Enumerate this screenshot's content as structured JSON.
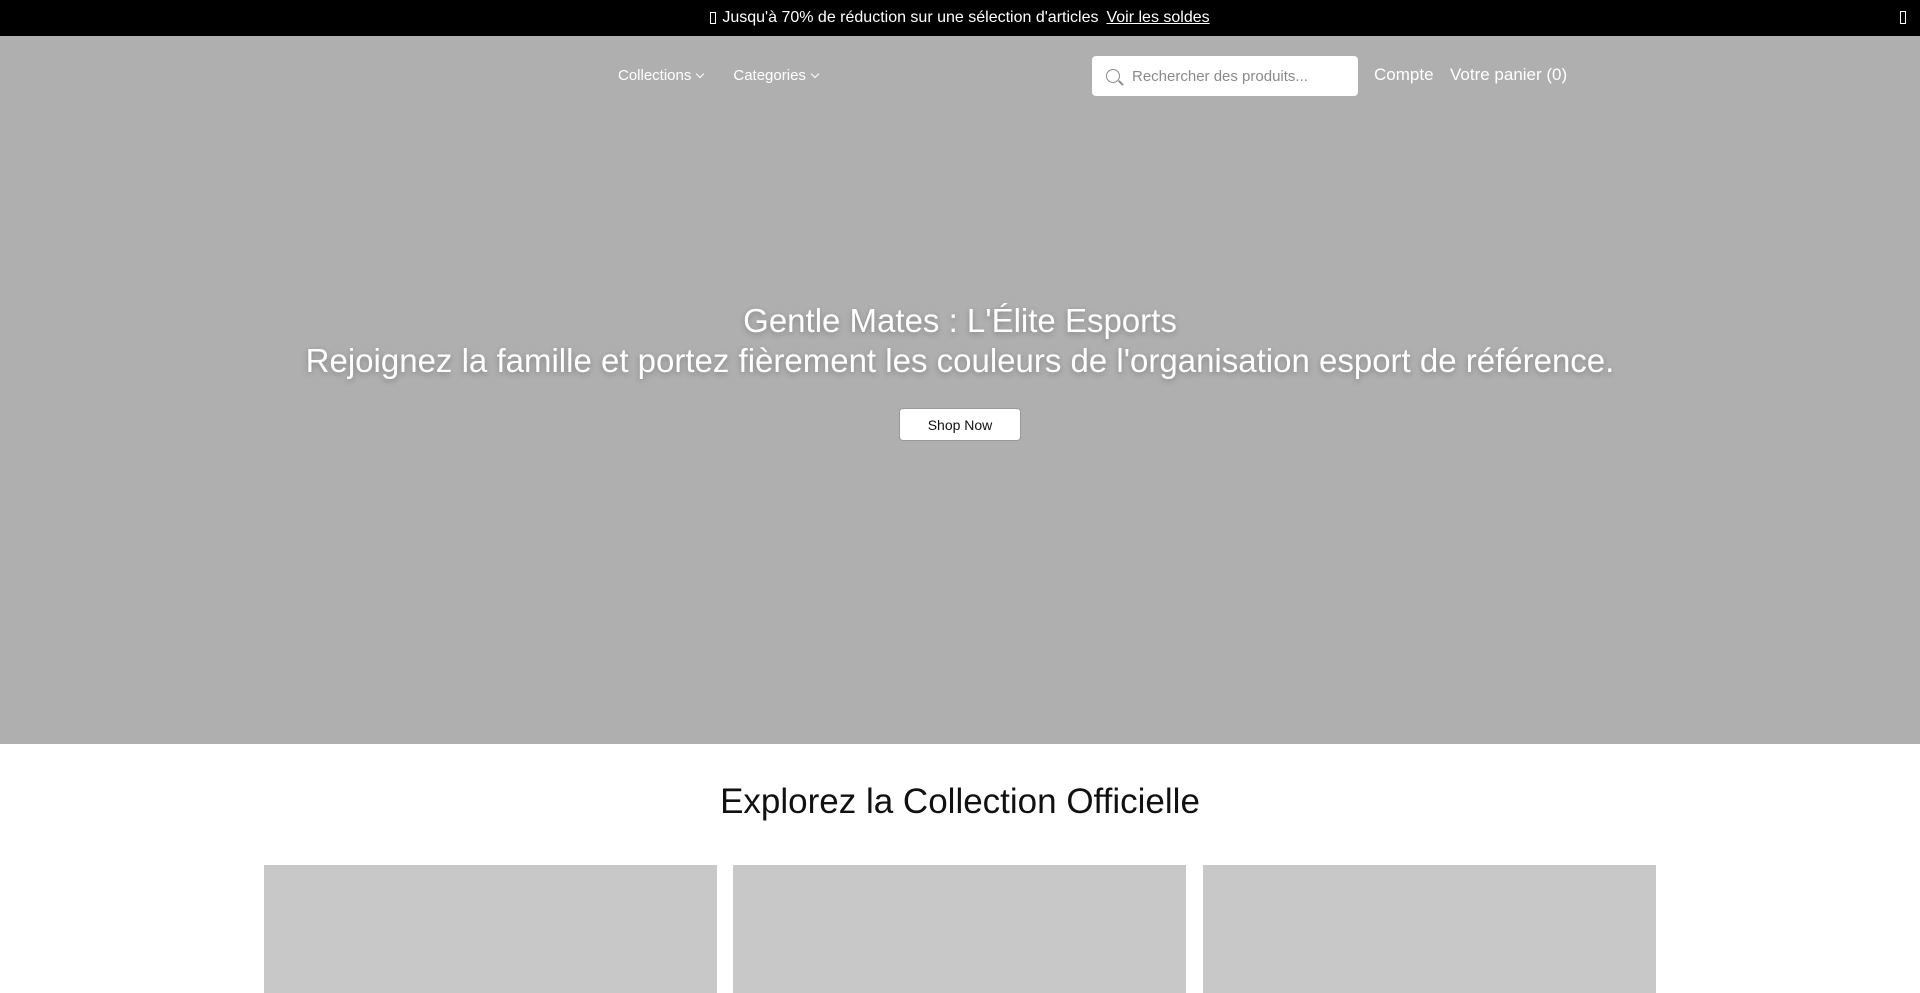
{
  "announcement": {
    "text": "Jusqu'à 70% de réduction sur une sélection d'articles",
    "link_label": "Voir les soldes"
  },
  "header": {
    "nav": [
      {
        "label": "Collections"
      },
      {
        "label": "Categories"
      }
    ],
    "search": {
      "placeholder": "Rechercher des produits..."
    },
    "account_label": "Compte",
    "cart_label": "Votre panier (0)"
  },
  "hero": {
    "title": "Gentle Mates : L'Élite Esports",
    "subtitle": "Rejoignez la famille et portez fièrement les couleurs de l'organisation esport de référence.",
    "cta_label": "Shop Now",
    "background_color": "#afafaf"
  },
  "collection": {
    "title": "Explorez la Collection Officielle",
    "card_count_visible": 3,
    "card_placeholder_color": "#c8c8c8"
  },
  "colors": {
    "announcement_bg": "#000000",
    "text_on_dark": "#ffffff"
  }
}
